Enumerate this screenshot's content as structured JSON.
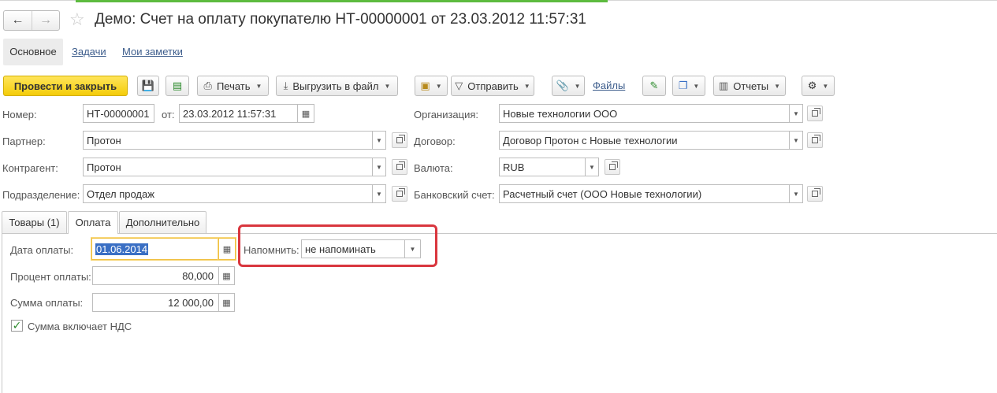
{
  "window": {
    "title": "Демо: Счет на оплату покупателю НТ-00000001 от 23.03.2012 11:57:31",
    "nav_back": "←",
    "nav_forward": "→",
    "favorite_icon": "star-icon"
  },
  "form_tabs": [
    {
      "label": "Основное"
    },
    {
      "label": "Задачи"
    },
    {
      "label": "Мои заметки"
    }
  ],
  "toolbar": {
    "post_close": "Провести и закрыть",
    "print": "Печать",
    "export": "Выгрузить в файл",
    "send": "Отправить",
    "files": "Файлы",
    "reports": "Отчеты"
  },
  "header_fields": {
    "number_label": "Номер:",
    "number_value": "НТ-00000001",
    "date_label": "от:",
    "date_value": "23.03.2012 11:57:31",
    "partner_label": "Партнер:",
    "partner_value": "Протон",
    "counterparty_label": "Контрагент:",
    "counterparty_value": "Протон",
    "department_label": "Подразделение:",
    "department_value": "Отдел продаж",
    "org_label": "Организация:",
    "org_value": "Новые технологии ООО",
    "contract_label": "Договор:",
    "contract_value": "Договор Протон с Новые технологии",
    "currency_label": "Валюта:",
    "currency_value": "RUB",
    "bank_label": "Банковский счет:",
    "bank_value": "Расчетный счет (ООО Новые технологии)"
  },
  "panel_tabs": [
    {
      "label": "Товары (1)"
    },
    {
      "label": "Оплата"
    },
    {
      "label": "Дополнительно"
    }
  ],
  "payment": {
    "date_label": "Дата оплаты:",
    "date_value": "01.06.2014",
    "remind_label": "Напомнить:",
    "remind_value": "не напоминать",
    "percent_label": "Процент оплаты:",
    "percent_value": "80,000",
    "sum_label": "Сумма оплаты:",
    "sum_value": "12 000,00",
    "vat_label": "Сумма включает НДС",
    "vat_checked": true
  },
  "colors": {
    "primary_button": "#f4cc0a",
    "highlight_box": "#d9363e",
    "link": "#3d5d8c"
  }
}
